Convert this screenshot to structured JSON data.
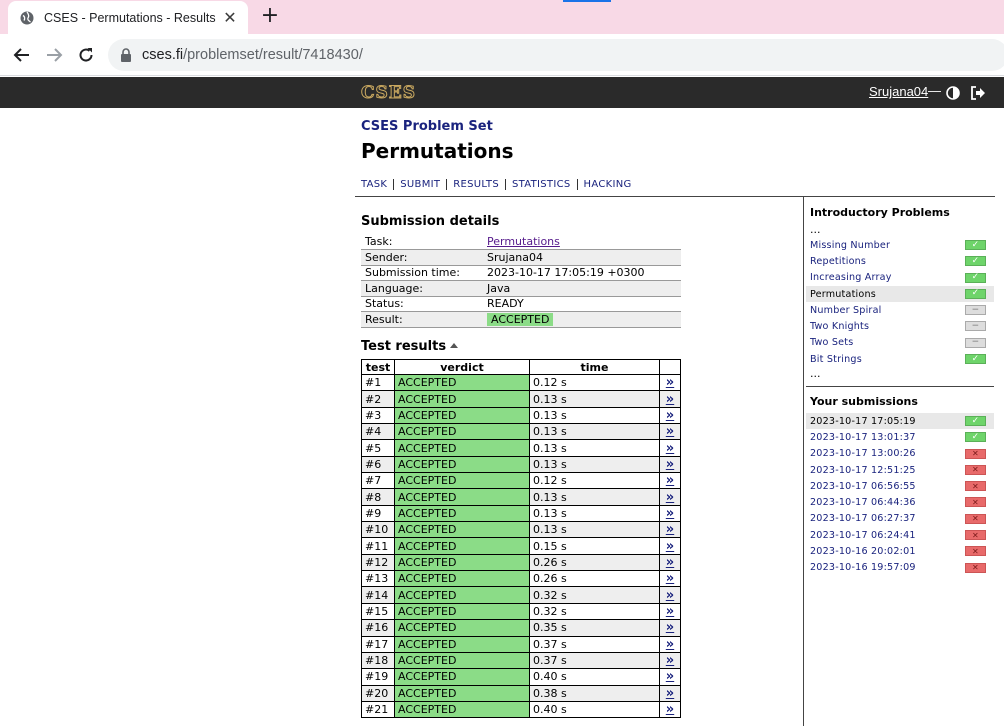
{
  "browser": {
    "tab_title": "CSES - Permutations - Results",
    "tab_close": "✕",
    "new_tab": "+",
    "url_host": "cses.fi",
    "url_path": "/problemset/result/7418430/"
  },
  "header": {
    "logo": "CSES",
    "user": "Srujana04",
    "dash": "—"
  },
  "page": {
    "problem_set": "CSES Problem Set",
    "title": "Permutations",
    "nav": [
      "TASK",
      "SUBMIT",
      "RESULTS",
      "STATISTICS",
      "HACKING"
    ]
  },
  "details": {
    "heading": "Submission details",
    "rows": [
      {
        "key": "Task:",
        "value": "Permutations"
      },
      {
        "key": "Sender:",
        "value": "Srujana04"
      },
      {
        "key": "Submission time:",
        "value": "2023-10-17 17:05:19 +0300"
      },
      {
        "key": "Language:",
        "value": "Java"
      },
      {
        "key": "Status:",
        "value": "READY"
      },
      {
        "key": "Result:",
        "value": "ACCEPTED"
      }
    ]
  },
  "tests": {
    "heading": "Test results",
    "columns": [
      "test",
      "verdict",
      "time",
      ""
    ],
    "link_glyph": "»",
    "rows": [
      {
        "test": "#1",
        "verdict": "ACCEPTED",
        "time": "0.12 s"
      },
      {
        "test": "#2",
        "verdict": "ACCEPTED",
        "time": "0.13 s"
      },
      {
        "test": "#3",
        "verdict": "ACCEPTED",
        "time": "0.13 s"
      },
      {
        "test": "#4",
        "verdict": "ACCEPTED",
        "time": "0.13 s"
      },
      {
        "test": "#5",
        "verdict": "ACCEPTED",
        "time": "0.13 s"
      },
      {
        "test": "#6",
        "verdict": "ACCEPTED",
        "time": "0.13 s"
      },
      {
        "test": "#7",
        "verdict": "ACCEPTED",
        "time": "0.12 s"
      },
      {
        "test": "#8",
        "verdict": "ACCEPTED",
        "time": "0.13 s"
      },
      {
        "test": "#9",
        "verdict": "ACCEPTED",
        "time": "0.13 s"
      },
      {
        "test": "#10",
        "verdict": "ACCEPTED",
        "time": "0.13 s"
      },
      {
        "test": "#11",
        "verdict": "ACCEPTED",
        "time": "0.15 s"
      },
      {
        "test": "#12",
        "verdict": "ACCEPTED",
        "time": "0.26 s"
      },
      {
        "test": "#13",
        "verdict": "ACCEPTED",
        "time": "0.26 s"
      },
      {
        "test": "#14",
        "verdict": "ACCEPTED",
        "time": "0.32 s"
      },
      {
        "test": "#15",
        "verdict": "ACCEPTED",
        "time": "0.32 s"
      },
      {
        "test": "#16",
        "verdict": "ACCEPTED",
        "time": "0.35 s"
      },
      {
        "test": "#17",
        "verdict": "ACCEPTED",
        "time": "0.37 s"
      },
      {
        "test": "#18",
        "verdict": "ACCEPTED",
        "time": "0.37 s"
      },
      {
        "test": "#19",
        "verdict": "ACCEPTED",
        "time": "0.40 s"
      },
      {
        "test": "#20",
        "verdict": "ACCEPTED",
        "time": "0.38 s"
      },
      {
        "test": "#21",
        "verdict": "ACCEPTED",
        "time": "0.40 s"
      }
    ]
  },
  "sidebar": {
    "section_title": "Introductory Problems",
    "ellipsis": "...",
    "problems": [
      {
        "name": "Missing Number",
        "status": "ok",
        "active": false
      },
      {
        "name": "Repetitions",
        "status": "ok",
        "active": false
      },
      {
        "name": "Increasing Array",
        "status": "ok",
        "active": false
      },
      {
        "name": "Permutations",
        "status": "ok",
        "active": true
      },
      {
        "name": "Number Spiral",
        "status": "none",
        "active": false
      },
      {
        "name": "Two Knights",
        "status": "none",
        "active": false
      },
      {
        "name": "Two Sets",
        "status": "none",
        "active": false
      },
      {
        "name": "Bit Strings",
        "status": "ok",
        "active": false
      }
    ],
    "submissions_title": "Your submissions",
    "submissions": [
      {
        "time": "2023-10-17 17:05:19",
        "status": "ok",
        "active": true
      },
      {
        "time": "2023-10-17 13:01:37",
        "status": "ok",
        "active": false
      },
      {
        "time": "2023-10-17 13:00:26",
        "status": "bad",
        "active": false
      },
      {
        "time": "2023-10-17 12:51:25",
        "status": "bad",
        "active": false
      },
      {
        "time": "2023-10-17 06:56:55",
        "status": "bad",
        "active": false
      },
      {
        "time": "2023-10-17 06:44:36",
        "status": "bad",
        "active": false
      },
      {
        "time": "2023-10-17 06:27:37",
        "status": "bad",
        "active": false
      },
      {
        "time": "2023-10-17 06:24:41",
        "status": "bad",
        "active": false
      },
      {
        "time": "2023-10-16 20:02:01",
        "status": "bad",
        "active": false
      },
      {
        "time": "2023-10-16 19:57:09",
        "status": "bad",
        "active": false
      }
    ],
    "marks": {
      "ok": "✓",
      "none": "−",
      "bad": "✕"
    }
  },
  "colors": {
    "accepted_bg": "#8bdc87",
    "link": "#1a237e",
    "header_bg": "#2a2a2a",
    "tabbar_bg": "#f8d9e6"
  }
}
